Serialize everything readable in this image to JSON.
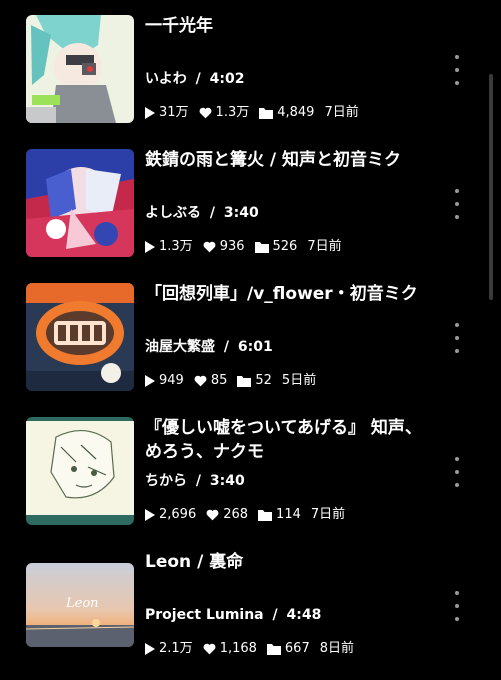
{
  "songs": [
    {
      "title": "一千光年",
      "artist": "いよわ",
      "duration": "4:02",
      "plays": "31万",
      "likes": "1.3万",
      "mylists": "4,849",
      "posted": "7日前"
    },
    {
      "title": "鉄錆の雨と篝火 / 知声と初音ミク",
      "artist": "よしぶる",
      "duration": "3:40",
      "plays": "1.3万",
      "likes": "936",
      "mylists": "526",
      "posted": "7日前"
    },
    {
      "title": "「回想列車」/v_flower・初音ミク",
      "artist": "油屋大繁盛",
      "duration": "6:01",
      "plays": "949",
      "likes": "85",
      "mylists": "52",
      "posted": "5日前"
    },
    {
      "title_line1": "『優しい嘘をついてあげる』 知声、",
      "title_line2": "めろう、ナクモ",
      "artist": "ちから",
      "duration": "3:40",
      "plays": "2,696",
      "likes": "268",
      "mylists": "114",
      "posted": "7日前"
    },
    {
      "title": "Leon / 裏命",
      "artist": "Project Lumina",
      "duration": "4:48",
      "plays": "2.1万",
      "likes": "1,168",
      "mylists": "667",
      "posted": "8日前",
      "thumb_text": "Leon"
    }
  ],
  "separator": "/",
  "icons": {
    "plays": "play-icon",
    "likes": "heart-icon",
    "mylists": "folder-icon",
    "more": "more-vertical-icon"
  },
  "colors": {
    "background": "#000000",
    "text": "#ffffff",
    "muted": "#9a9a9a"
  }
}
